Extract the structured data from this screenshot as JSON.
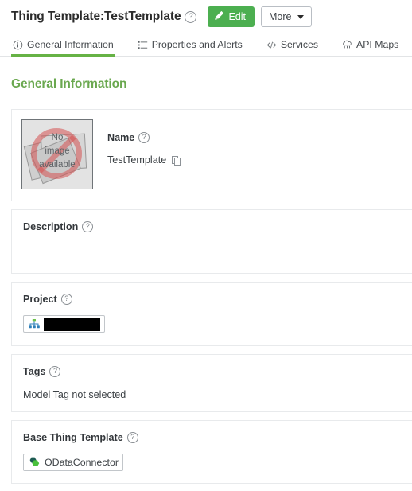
{
  "header": {
    "title_prefix": "Thing Template:",
    "title_entity": "TestTemplate",
    "help_icon": "help-circle-icon",
    "edit_label": "Edit",
    "edit_icon": "pencil-icon",
    "more_label": "More",
    "more_icon": "chevron-down-icon",
    "accent_green": "#4caf50"
  },
  "tabs": [
    {
      "label": "General Information",
      "icon": "info-circle-icon",
      "active": true
    },
    {
      "label": "Properties and Alerts",
      "icon": "list-icon",
      "active": false
    },
    {
      "label": "Services",
      "icon": "code-brackets-icon",
      "active": false
    },
    {
      "label": "API Maps",
      "icon": "cloud-api-icon",
      "active": false
    }
  ],
  "main": {
    "section_heading": "General Information",
    "section_heading_color": "#6aa84f",
    "image": {
      "placeholder_line1": "No",
      "placeholder_line2": "image",
      "placeholder_line3": "available",
      "icon": "no-image-available-icon"
    },
    "fields": {
      "name": {
        "label": "Name",
        "value": "TestTemplate",
        "copy_icon": "copy-icon"
      },
      "description": {
        "label": "Description",
        "value": ""
      },
      "project": {
        "label": "Project",
        "value": "",
        "redacted": true,
        "icon": "project-tree-icon"
      },
      "tags": {
        "label": "Tags",
        "value": "Model Tag not selected"
      },
      "base_thing_template": {
        "label": "Base Thing Template",
        "value": "ODataConnector",
        "icon": "thing-template-hexagon-icon"
      }
    }
  }
}
